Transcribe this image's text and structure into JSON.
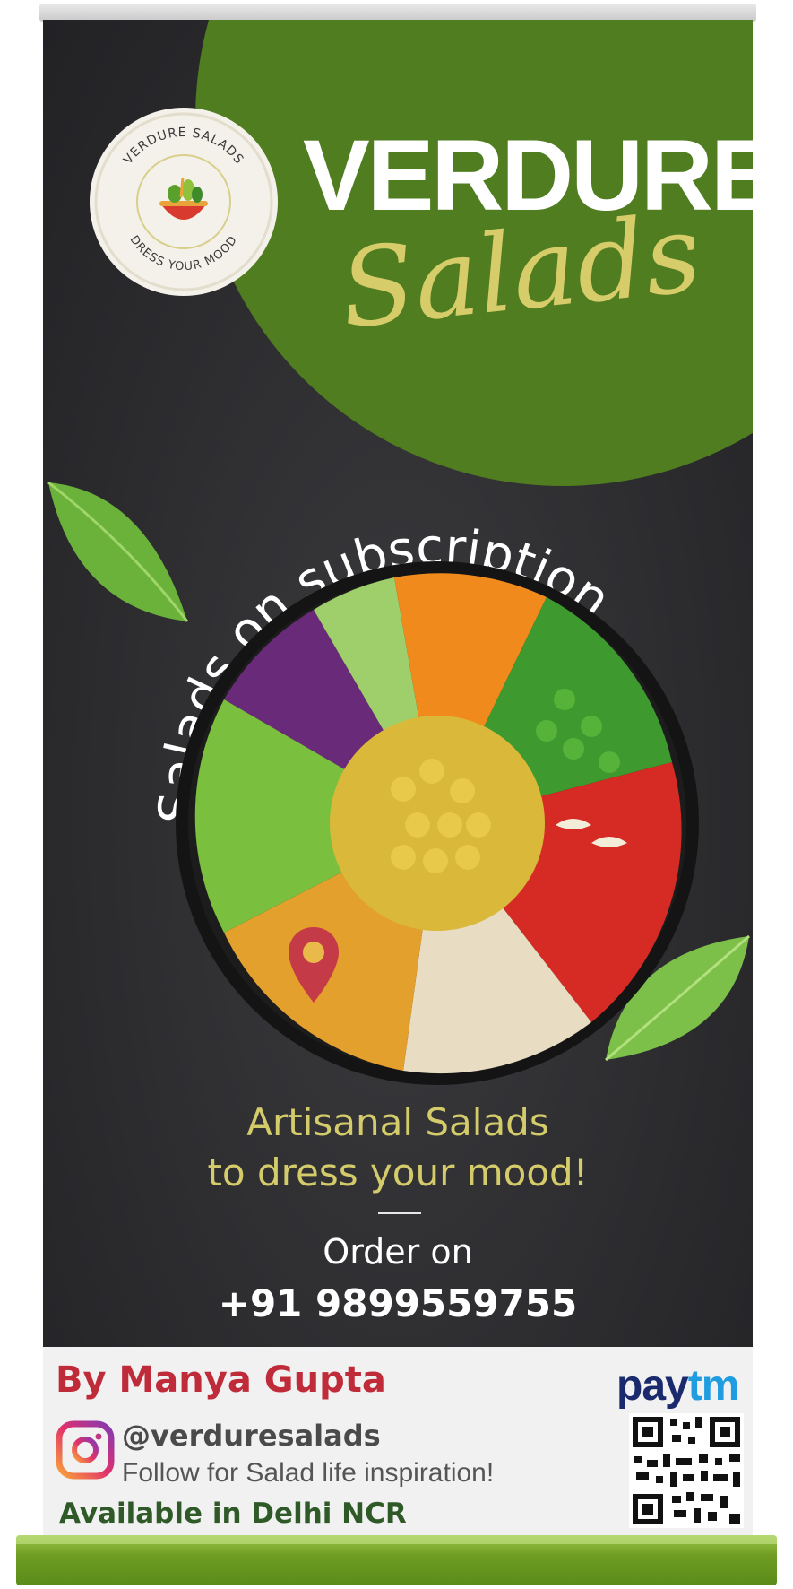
{
  "brand": {
    "logo_ring_top": "VERDURE SALADS",
    "logo_ring_bottom": "DRESS YOUR MOOD",
    "title": "VERDURE",
    "script_title": "Salads"
  },
  "headline_arc": "Salads on subscription",
  "tagline": {
    "line1": "Artisanal Salads",
    "line2": "to dress your mood!"
  },
  "order": {
    "label": "Order on",
    "phone": "+91 9899559755"
  },
  "footer": {
    "author": "By Manya Gupta",
    "instagram_handle": "@verduresalads",
    "follow_text": "Follow for Salad life inspiration!",
    "availability": "Available in Delhi NCR",
    "payment_brand_pay": "pay",
    "payment_brand_tm": "tm"
  },
  "icons": [
    "salad-bowl-logo-icon",
    "location-pin-icon",
    "instagram-icon",
    "qr-code-icon",
    "leaf-icon"
  ],
  "colors": {
    "banner_dark": "#2d2d30",
    "brand_green": "#4f7d1f",
    "script_gold": "#d7cc6a",
    "author_red": "#c02b39",
    "availability_green": "#2f5a28",
    "paytm_navy": "#1a2a6c",
    "paytm_blue": "#1f9de0"
  }
}
